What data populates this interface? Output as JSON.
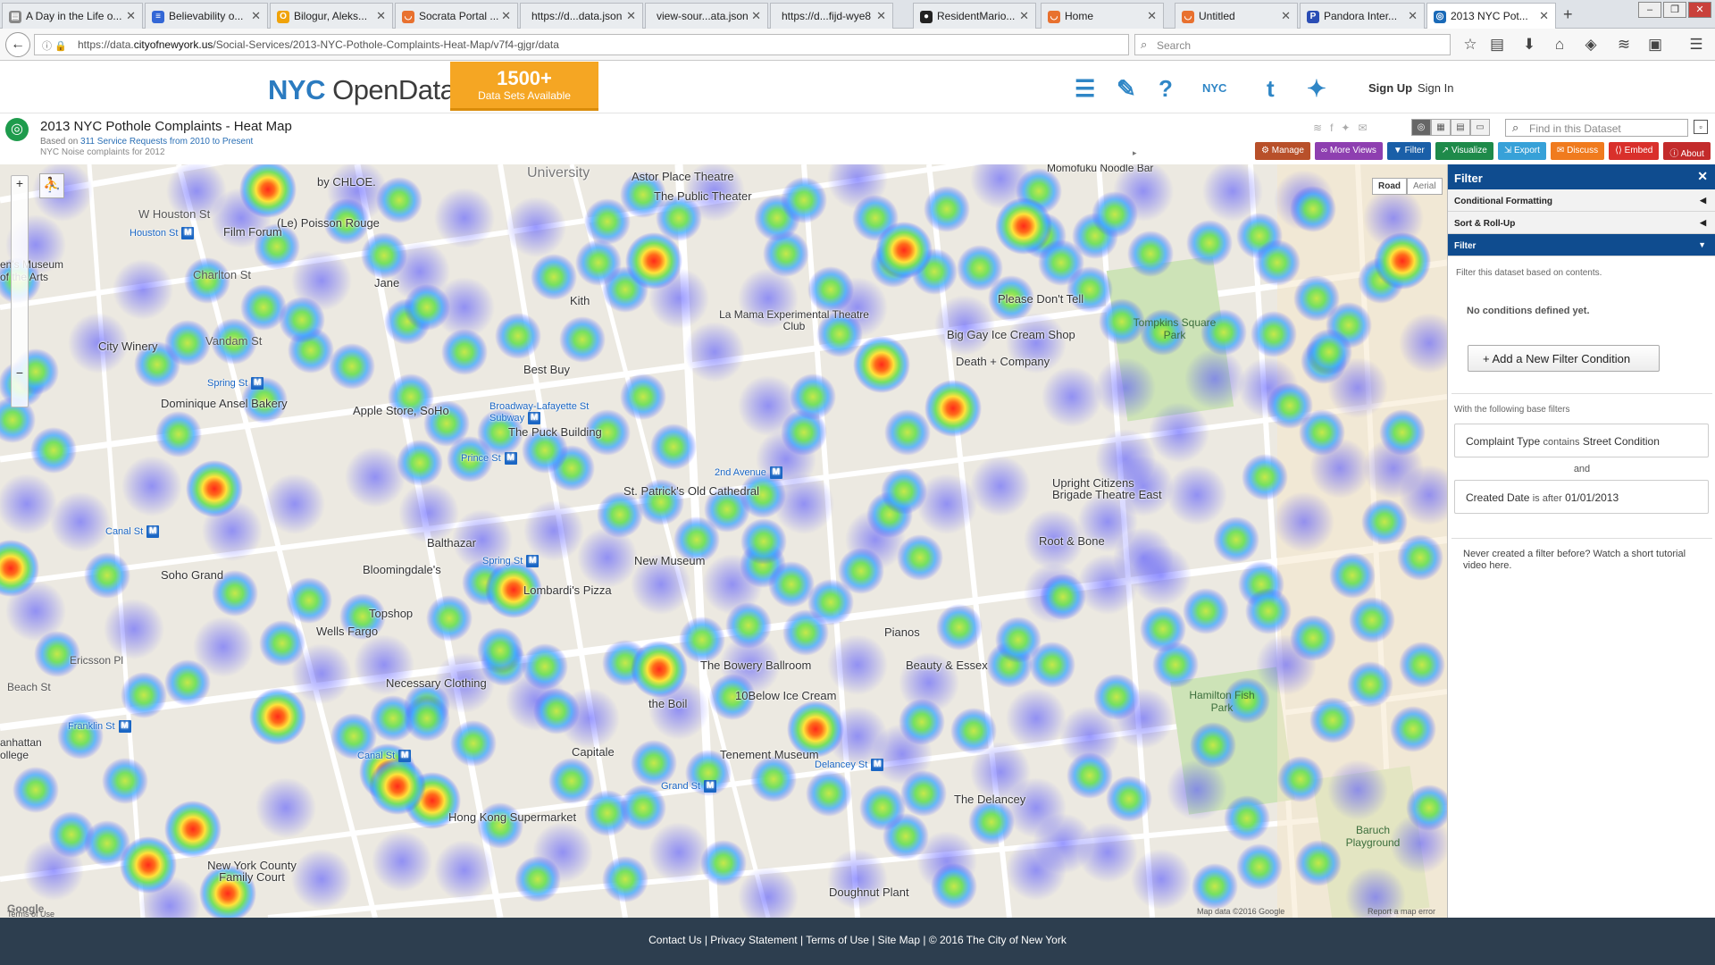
{
  "browser": {
    "tabs": [
      {
        "label": "A Day in the Life o...",
        "icon": "doc-icon",
        "color": "#888"
      },
      {
        "label": "Believability o...",
        "icon": "docs-icon",
        "color": "#3367d6"
      },
      {
        "label": "Bilogur, Aleks...",
        "icon": "notes-icon",
        "color": "#f0a30a"
      },
      {
        "label": "Socrata Portal ...",
        "icon": "socrata-icon",
        "color": "#e8712f"
      },
      {
        "label": "https://d...data.json",
        "icon": "page-icon",
        "color": "#aaa"
      },
      {
        "label": "view-sour...ata.json",
        "icon": "page-icon",
        "color": "#aaa"
      },
      {
        "label": "https://d...fijd-wye8",
        "icon": "page-icon",
        "color": "#aaa"
      },
      {
        "label": "ResidentMario...",
        "icon": "github-icon",
        "color": "#222"
      },
      {
        "label": "Home",
        "icon": "socrata-icon",
        "color": "#e8712f"
      },
      {
        "label": "Untitled",
        "icon": "socrata-icon",
        "color": "#e8712f"
      },
      {
        "label": "Pandora Inter...",
        "icon": "pandora-icon",
        "color": "#2a4db5"
      },
      {
        "label": "2013 NYC Pot...",
        "icon": "data-icon",
        "color": "#1a6ab8",
        "active": true
      }
    ],
    "url_prefix": "https://data.",
    "url_host": "cityofnewyork.us",
    "url_path": "/Social-Services/2013-NYC-Pothole-Complaints-Heat-Map/v7f4-gjgr/data",
    "search_placeholder": "Search"
  },
  "site": {
    "logo_nyc": "NYC",
    "logo_text": "OpenData",
    "promo_count": "1500+",
    "promo_label": "Data Sets Available",
    "nyc_small": "NYC",
    "signup": "Sign Up",
    "signin": "Sign In"
  },
  "dataset": {
    "title": "2013 NYC Pothole Complaints - Heat Map",
    "based_on_prefix": "Based on ",
    "based_on_link": "311 Service Requests from 2010 to Present",
    "subtitle": "NYC Noise complaints for 2012",
    "find_placeholder": "Find in this Dataset",
    "actions": [
      {
        "label": "Manage",
        "icon": "gear-icon",
        "color": "#b8502a"
      },
      {
        "label": "More Views",
        "icon": "views-icon",
        "color": "#8e3fb0"
      },
      {
        "label": "Filter",
        "icon": "filter-icon",
        "color": "#1a5fa8"
      },
      {
        "label": "Visualize",
        "icon": "chart-icon",
        "color": "#1e8a4a"
      },
      {
        "label": "Export",
        "icon": "export-icon",
        "color": "#37a1d8"
      },
      {
        "label": "Discuss",
        "icon": "discuss-icon",
        "color": "#f07b1e"
      },
      {
        "label": "Embed",
        "icon": "embed-icon",
        "color": "#d9302b"
      },
      {
        "label": "About",
        "icon": "info-icon",
        "color": "#c32b2b"
      }
    ]
  },
  "map": {
    "road_label": "Road",
    "aerial_label": "Aerial",
    "google": "Google",
    "terms": "Terms of Use",
    "map_data": "Map data ©2016 Google",
    "report": "Report a map error",
    "places": [
      "University",
      "Astor Place Theatre",
      "The Public Theater",
      "Momofuku Noodle Bar",
      "by CHLOE.",
      "(Le) Poisson Rouge",
      "W Houston St",
      "Houston St",
      "Film Forum",
      "en's Museum of the Arts",
      "Charlton St",
      "Jane",
      "Kith",
      "La Mama Experimental Theatre Club",
      "Big Gay Ice Cream Shop",
      "Please Don't Tell",
      "Tompkins Square Park",
      "Death + Company",
      "City Winery",
      "Vandam St",
      "Spring St",
      "Best Buy",
      "Dominique Ansel Bakery",
      "Apple Store, SoHo",
      "Broadway-Lafayette St Subway",
      "The Puck Building",
      "Prince St",
      "2nd Avenue",
      "Upright Citizens Brigade Theatre East",
      "St. Patrick's Old Cathedral",
      "Canal St",
      "Balthazar",
      "Bloomingdale's",
      "Spring St",
      "Lombardi's Pizza",
      "New Museum",
      "Root & Bone",
      "Soho Grand",
      "Topshop",
      "Wells Fargo",
      "Ericsson Pl",
      "Pianos",
      "Necessary Clothing",
      "The Bowery Ballroom",
      "Beauty & Essex",
      "the Boil",
      "10Below Ice Cream",
      "Hamilton Fish Park",
      "Franklin St",
      "Capitale",
      "Tenement Museum",
      "Delancey St",
      "The Delancey",
      "Canal St",
      "Grand St",
      "Hong Kong Supermarket",
      "New York County Family Court",
      "Baruch Playground",
      "Doughnut Plant",
      "Beach St",
      "anhattan ollege"
    ]
  },
  "panel": {
    "title": "Filter",
    "sections": [
      "Conditional Formatting",
      "Sort & Roll-Up",
      "Filter"
    ],
    "description": "Filter this dataset based on contents.",
    "no_conditions": "No conditions defined yet.",
    "add_button": "Add a New Filter Condition",
    "base_label": "With the following base filters",
    "filter1_field": "Complaint Type",
    "filter1_op": "contains",
    "filter1_value": "Street Condition",
    "and_label": "and",
    "filter2_field": "Created Date",
    "filter2_op": "is after",
    "filter2_value": "01/01/2013",
    "never_text": "Never created a filter before? Watch a short tutorial video here."
  },
  "footer": {
    "text": "Contact Us | Privacy Statement | Terms of Use | Site Map | © 2016 The City of New York"
  }
}
